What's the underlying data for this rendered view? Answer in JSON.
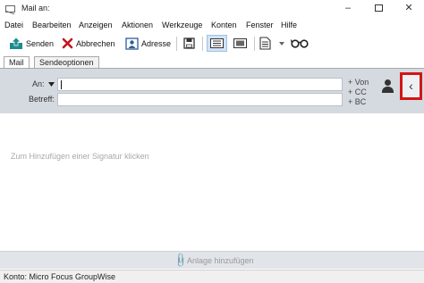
{
  "window": {
    "title": "Mail an:",
    "minimize": "–",
    "close": "✕"
  },
  "menu": [
    "Datei",
    "Bearbeiten",
    "Anzeigen",
    "Aktionen",
    "Werkzeuge",
    "Konten",
    "Fenster",
    "Hilfe"
  ],
  "toolbar": {
    "send_label": "Senden",
    "cancel_label": "Abbrechen",
    "address_label": "Adresse"
  },
  "tabs": [
    "Mail",
    "Sendeoptionen"
  ],
  "header": {
    "to_label": "An:",
    "to_value": "",
    "subject_label": "Betreff:",
    "subject_value": "",
    "to_link": "+ Von",
    "cc_link": "+ CC",
    "bc_link": "+ BC"
  },
  "body": {
    "signature_placeholder": "Zum Hinzufügen einer Signatur klicken"
  },
  "attach": {
    "label": "Anlage hinzufügen"
  },
  "status": {
    "account": "Konto: Micro Focus GroupWise"
  },
  "colors": {
    "header_bg": "#d5dae0",
    "highlight_border": "#d11717",
    "cancel_red": "#c0161d",
    "send_teal": "#1e8c8c"
  }
}
